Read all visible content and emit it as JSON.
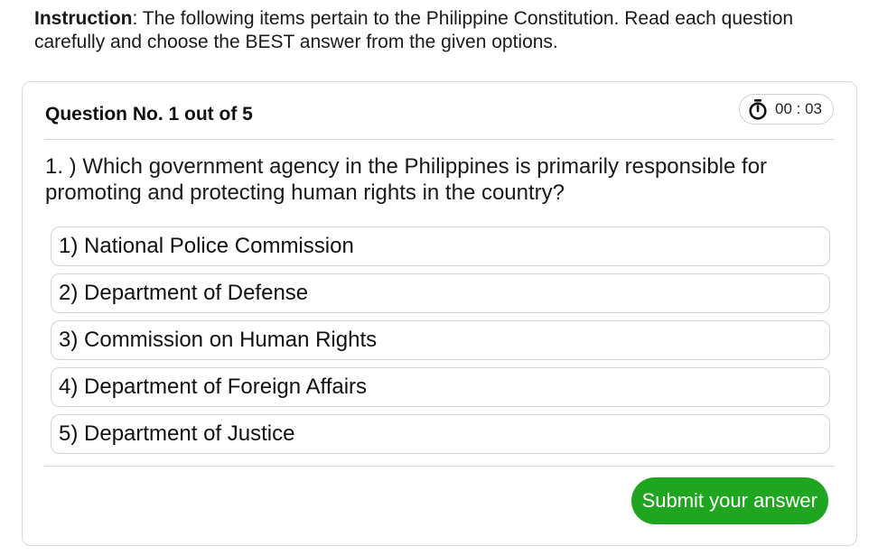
{
  "instruction": {
    "label": "Instruction",
    "text": ": The following items pertain to the Philippine Constitution. Read each question carefully and choose the BEST answer from the given options."
  },
  "quiz": {
    "header": "Question No. 1 out of 5",
    "timer": "00 : 03",
    "question": "1. ) Which government agency in the Philippines is primarily responsible for promoting and protecting human rights in the country?",
    "options": [
      "1) National Police Commission",
      "2) Department of Defense",
      "3) Commission on Human Rights",
      "4) Department of Foreign Affairs",
      "5) Department of Justice"
    ],
    "submit_label": "Submit your answer"
  },
  "colors": {
    "submit_bg": "#1fa51f",
    "border": "#d4d4d4"
  },
  "icons": {
    "timer": "stopwatch-icon"
  }
}
